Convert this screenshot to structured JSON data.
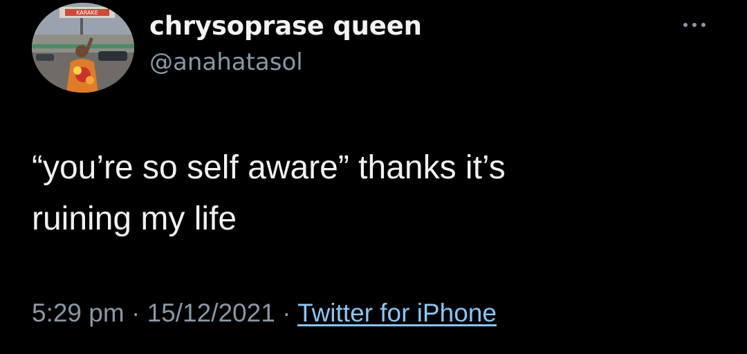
{
  "user": {
    "display_name": "chrysoprase queen",
    "handle": "@anahatasol",
    "avatar_sign_text": "KARAKE"
  },
  "header": {
    "more_icon": "more-horizontal-icon"
  },
  "tweet": {
    "text_line_1": "“you’re so self aware” thanks it’s",
    "text_line_2": "ruining my life"
  },
  "meta": {
    "time": "5:29 pm",
    "separator": "·",
    "date": "15/12/2021",
    "source": "Twitter for iPhone"
  },
  "colors": {
    "background": "#000000",
    "text": "#f2f2f2",
    "secondary": "#8b98a5",
    "link": "#8ec5f0"
  }
}
